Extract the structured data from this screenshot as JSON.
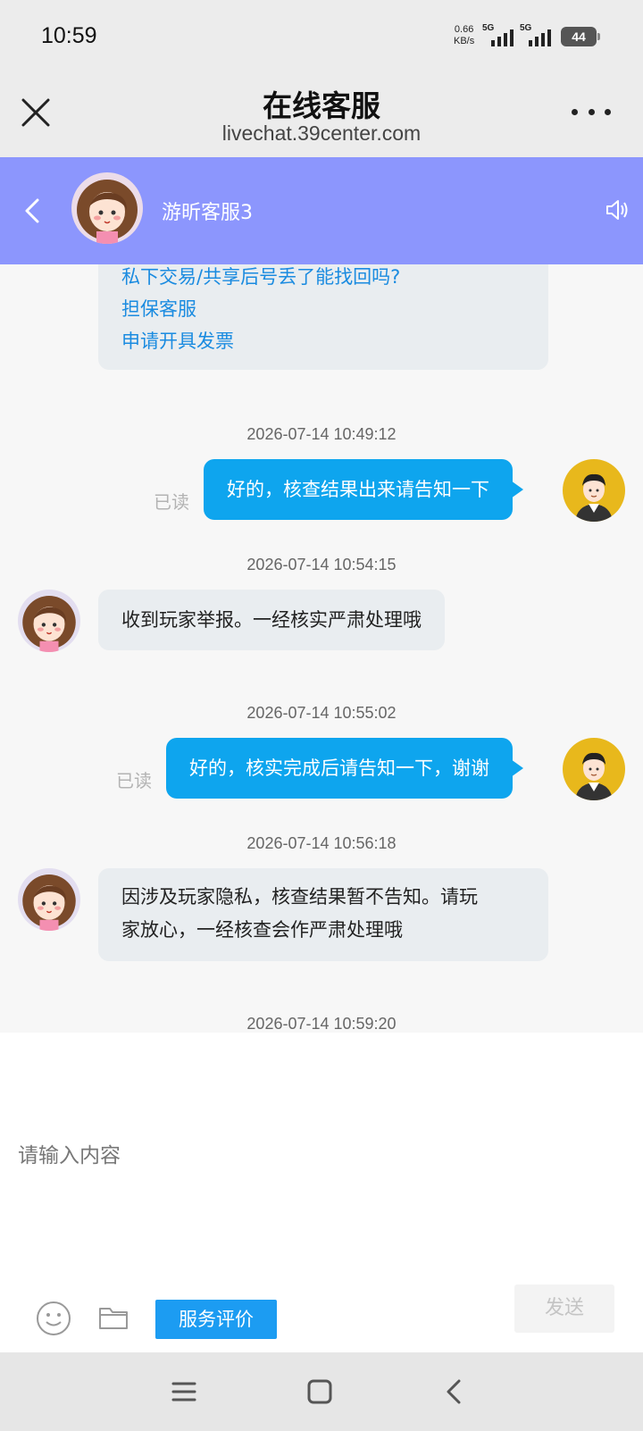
{
  "status_bar": {
    "time": "10:59",
    "net_speed_value": "0.66",
    "net_speed_unit": "KB/s",
    "signal_1_label": "5G",
    "signal_2_label": "5G",
    "battery": "44"
  },
  "browser_header": {
    "title": "在线客服",
    "url": "livechat.39center.com"
  },
  "chat_header": {
    "agent_name": "游昕客服3"
  },
  "messages": {
    "links": [
      "私下交易/共享后号丢了能找回吗?",
      "担保客服",
      "申请开具发票"
    ],
    "ts1": "2026-07-14 10:49:12",
    "user_msg1": "好的，核查结果出来请告知一下",
    "read1": "已读",
    "ts2": "2026-07-14 10:54:15",
    "agent_msg1": "收到玩家举报。一经核实严肃处理哦",
    "ts3": "2026-07-14 10:55:02",
    "user_msg2": "好的，核实完成后请告知一下，谢谢",
    "read2": "已读",
    "ts4": "2026-07-14 10:56:18",
    "agent_msg2_line1": "因涉及玩家隐私，核查结果暂不告知。请玩",
    "agent_msg2_line2": "家放心，一经核查会作严肃处理哦",
    "ts5": "2026-07-14 10:59:20"
  },
  "composer": {
    "placeholder": "请输入内容",
    "rate_label": "服务评价",
    "send_label": "发送"
  },
  "icons": {
    "close": "close-icon",
    "more": "more-icon",
    "back": "back-icon",
    "speaker": "speaker-icon",
    "emoji": "emoji-icon",
    "folder": "folder-icon",
    "nav_menu": "menu-icon",
    "nav_home": "home-icon",
    "nav_back": "back-icon"
  },
  "colors": {
    "chat_header_bg": "#8c96fd",
    "user_bubble": "#0ea5ee",
    "agent_bubble": "#e9edf0",
    "link": "#1a8be0",
    "rate_button": "#1c9cf2"
  }
}
